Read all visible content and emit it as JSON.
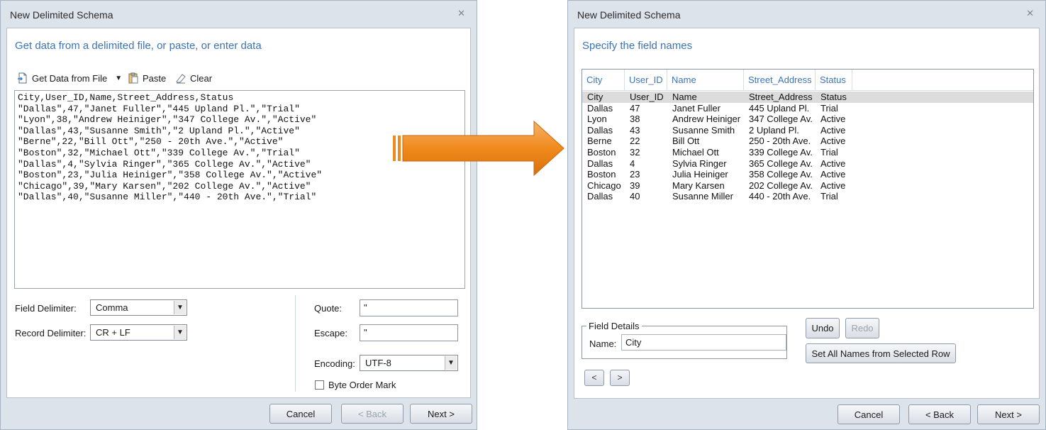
{
  "left_dialog": {
    "title": "New Delimited Schema",
    "close": "✕",
    "heading": "Get data from a delimited file, or paste, or enter data",
    "toolbar": {
      "get_data": "Get Data from File",
      "get_data_caret": "▼",
      "paste": "Paste",
      "clear": "Clear"
    },
    "data_text": "City,User_ID,Name,Street_Address,Status\n\"Dallas\",47,\"Janet Fuller\",\"445 Upland Pl.\",\"Trial\"\n\"Lyon\",38,\"Andrew Heiniger\",\"347 College Av.\",\"Active\"\n\"Dallas\",43,\"Susanne Smith\",\"2 Upland Pl.\",\"Active\"\n\"Berne\",22,\"Bill Ott\",\"250 - 20th Ave.\",\"Active\"\n\"Boston\",32,\"Michael Ott\",\"339 College Av.\",\"Trial\"\n\"Dallas\",4,\"Sylvia Ringer\",\"365 College Av.\",\"Active\"\n\"Boston\",23,\"Julia Heiniger\",\"358 College Av.\",\"Active\"\n\"Chicago\",39,\"Mary Karsen\",\"202 College Av.\",\"Active\"\n\"Dallas\",40,\"Susanne Miller\",\"440 - 20th Ave.\",\"Trial\"",
    "field_delimiter_label": "Field Delimiter:",
    "field_delimiter_value": "Comma",
    "record_delimiter_label": "Record Delimiter:",
    "record_delimiter_value": "CR + LF",
    "quote_label": "Quote:",
    "quote_value": "\"",
    "escape_label": "Escape:",
    "escape_value": "\"",
    "encoding_label": "Encoding:",
    "encoding_value": "UTF-8",
    "byte_order_mark_label": "Byte Order Mark",
    "byte_order_mark_checked": false,
    "combo_arrow": "▼",
    "buttons": {
      "cancel": "Cancel",
      "back": "< Back",
      "next": "Next >"
    }
  },
  "right_dialog": {
    "title": "New Delimited Schema",
    "close": "✕",
    "heading": "Specify the field names",
    "grid": {
      "columns": [
        "City",
        "User_ID",
        "Name",
        "Street_Address",
        "Status"
      ],
      "rows": [
        [
          "City",
          "User_ID",
          "Name",
          "Street_Address",
          "Status"
        ],
        [
          "Dallas",
          "47",
          "Janet Fuller",
          "445 Upland Pl.",
          "Trial"
        ],
        [
          "Lyon",
          "38",
          "Andrew Heiniger",
          "347 College Av.",
          "Active"
        ],
        [
          "Dallas",
          "43",
          "Susanne Smith",
          "2 Upland Pl.",
          "Active"
        ],
        [
          "Berne",
          "22",
          "Bill Ott",
          "250 - 20th Ave.",
          "Active"
        ],
        [
          "Boston",
          "32",
          "Michael Ott",
          "339 College Av.",
          "Trial"
        ],
        [
          "Dallas",
          "4",
          "Sylvia Ringer",
          "365 College Av.",
          "Active"
        ],
        [
          "Boston",
          "23",
          "Julia Heiniger",
          "358 College Av.",
          "Active"
        ],
        [
          "Chicago",
          "39",
          "Mary Karsen",
          "202 College Av.",
          "Active"
        ],
        [
          "Dallas",
          "40",
          "Susanne Miller",
          "440 - 20th Ave.",
          "Trial"
        ]
      ]
    },
    "field_details_legend": "Field Details",
    "name_label": "Name:",
    "name_value": "City",
    "undo": "Undo",
    "redo": "Redo",
    "set_all_names": "Set All Names from Selected Row",
    "prev": "<",
    "next_col": ">",
    "buttons": {
      "cancel": "Cancel",
      "back": "< Back",
      "next": "Next >"
    }
  },
  "colors": {
    "heading_blue": "#3c73b5",
    "arrow_orange": "#f08a1c"
  }
}
